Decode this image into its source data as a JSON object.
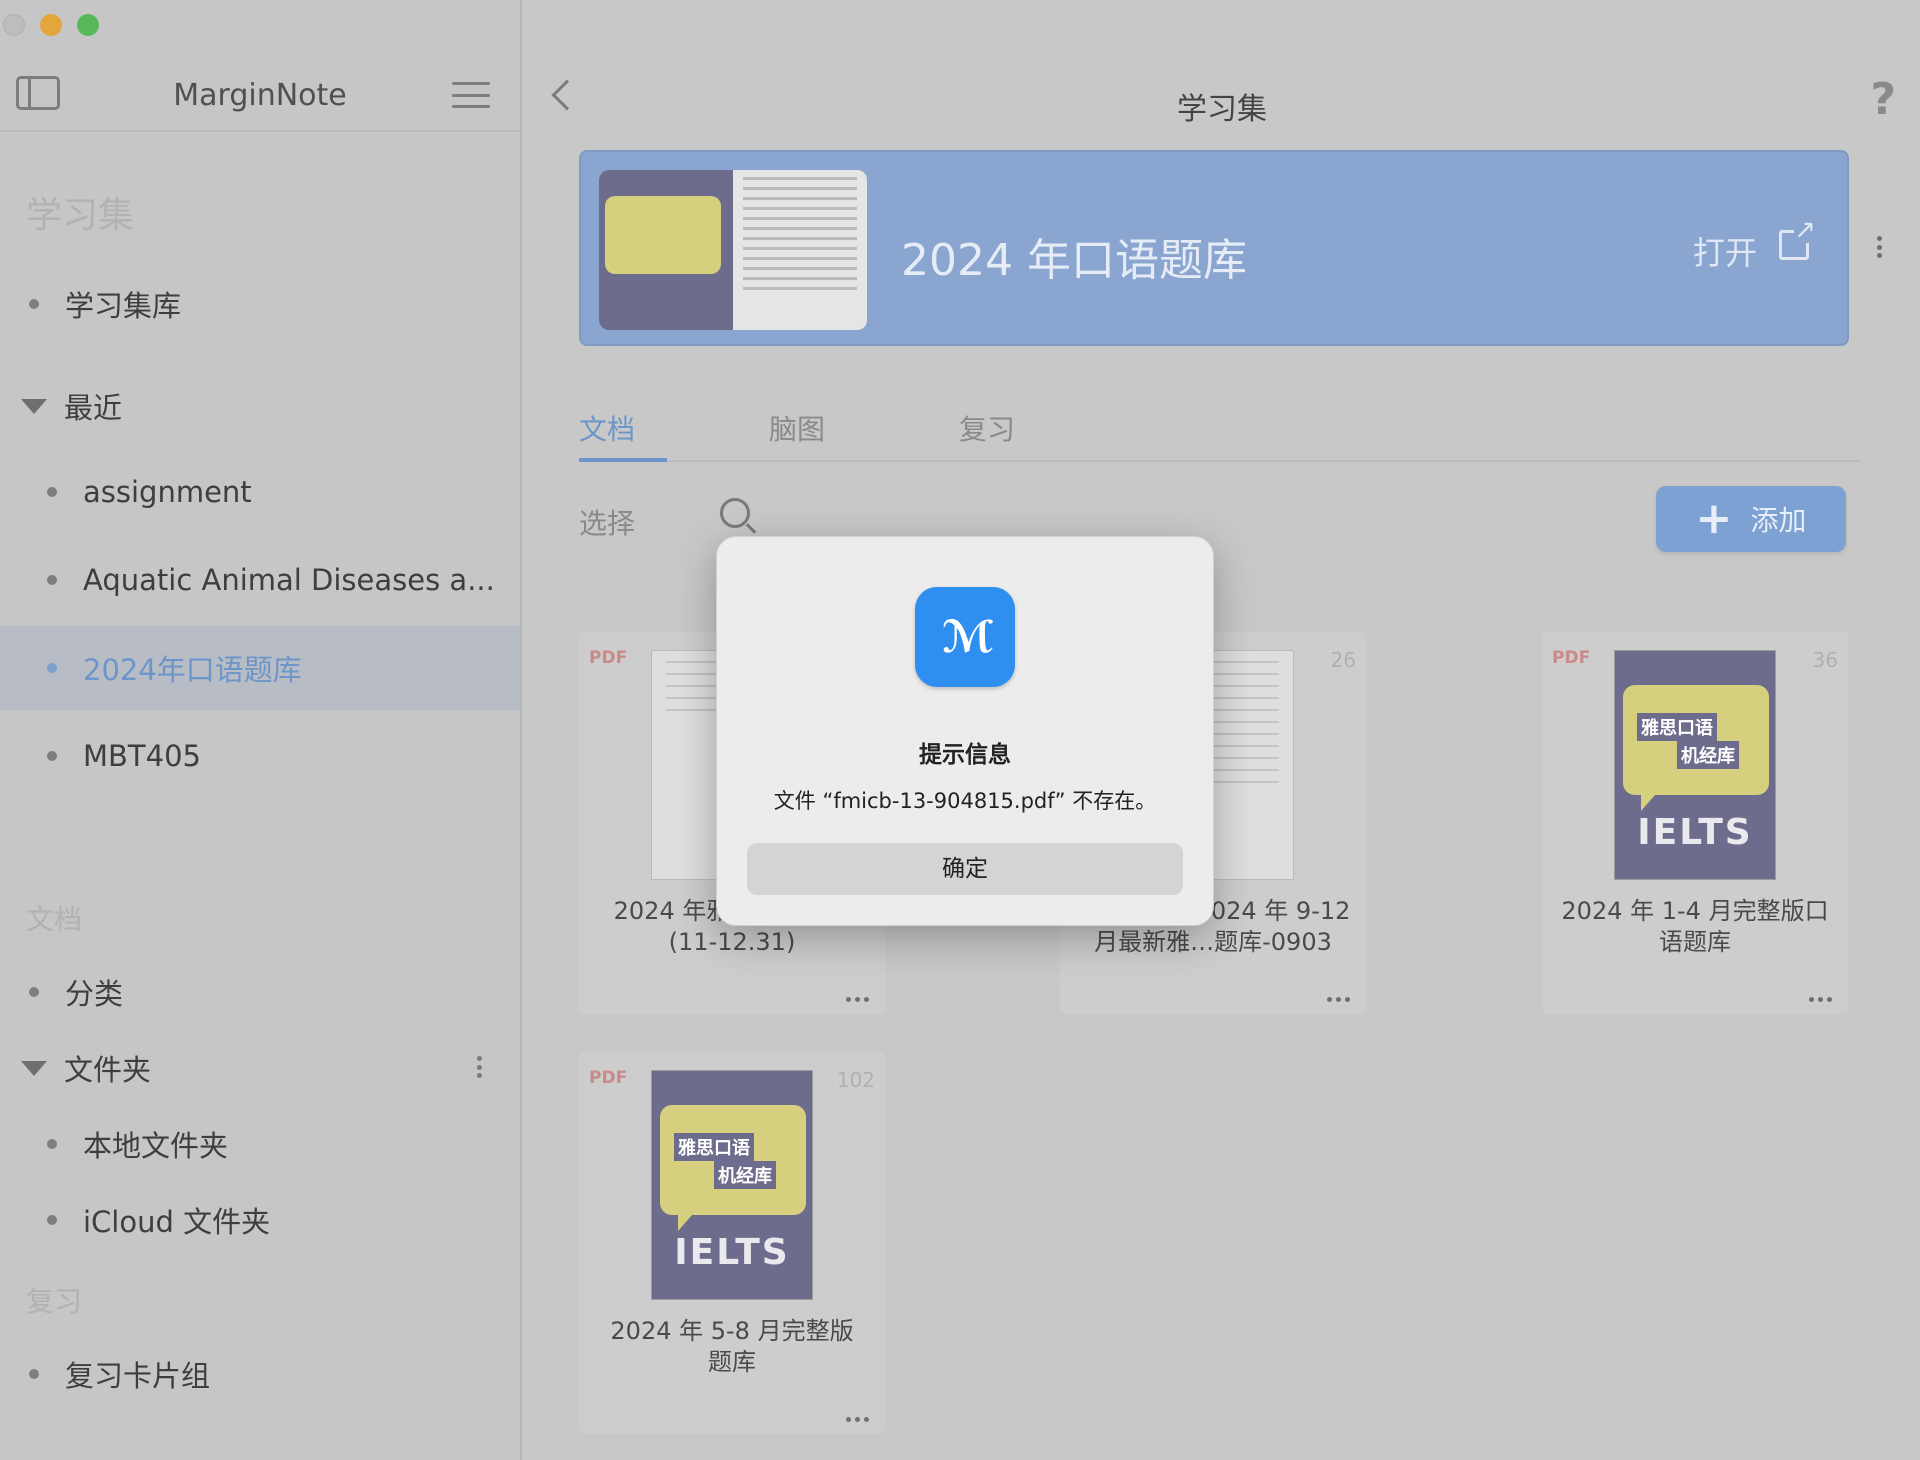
{
  "sidebar": {
    "app_title": "MarginNote",
    "section_notebooks": "学习集",
    "library_label": "学习集库",
    "recent_label": "最近",
    "recent_items": [
      "assignment",
      "Aquatic Animal Diseases a...",
      "2024年口语题库",
      "MBT405"
    ],
    "section_documents": "文档",
    "categories_label": "分类",
    "folders_label": "文件夹",
    "folder_items": [
      "本地文件夹",
      "iCloud 文件夹"
    ],
    "section_review": "复习",
    "review_label": "复习卡片组"
  },
  "main": {
    "title": "学习集",
    "help": "?",
    "banner": {
      "title": "2024 年口语题库",
      "open_label": "打开"
    },
    "tabs": [
      "文档",
      "脑图",
      "复习"
    ],
    "select_label": "选择",
    "add_label": "添加",
    "cards": [
      {
        "type": "PDF",
        "pages": "",
        "title": "2024 年雅思口语题库\n(11-12.31)"
      },
      {
        "type": "",
        "pages": "26",
        "title": "【雅思网】2024 年 9-12\n月最新雅…题库-0903"
      },
      {
        "type": "PDF",
        "pages": "36",
        "title": "2024 年 1-4 月完整版口\n语题库"
      },
      {
        "type": "PDF",
        "pages": "102",
        "title": "2024 年 5-8 月完整版\n题库"
      }
    ],
    "cover": {
      "line1": "雅思口语",
      "line2": "机经库",
      "brand": "IELTS"
    }
  },
  "dialog": {
    "title": "提示信息",
    "message": "文件 “fmicb-13-904815.pdf” 不存在。",
    "ok_label": "确定"
  },
  "colors": {
    "accent": "#6e95c9",
    "banner": "#8aa6d0",
    "app_icon": "#2f8ff0",
    "sidebar_bg": "#c6c6c6",
    "main_bg": "#c8c8c8"
  }
}
